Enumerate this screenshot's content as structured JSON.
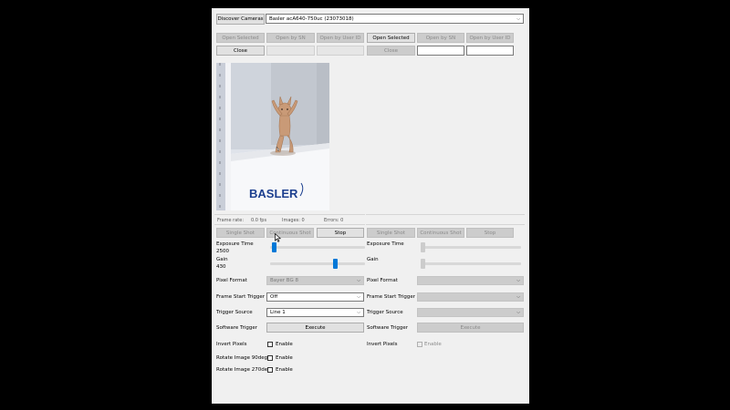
{
  "top": {
    "discover_label": "Discover Cameras",
    "camera_selected": "Basler acA640-750uc (23073018)"
  },
  "left_panel": {
    "open_selected": "Open Selected",
    "open_by_sn": "Open by SN",
    "open_by_user_id": "Open by User ID",
    "close": "Close",
    "status": {
      "frame_rate": "Frame rate:",
      "fps": "0.0 fps",
      "images": "Images: 0",
      "errors": "Errors: 0"
    },
    "single_shot": "Single Shot",
    "continuous_shot": "Continuous Shot",
    "stop": "Stop",
    "exposure_label": "Exposure Time",
    "exposure_value": "2500",
    "gain_label": "Gain",
    "gain_value": "430",
    "pixel_format_label": "Pixel Format",
    "pixel_format_value": "Bayer BG 8",
    "frame_start_trigger_label": "Frame Start Trigger",
    "frame_start_trigger_value": "Off",
    "trigger_source_label": "Trigger Source",
    "trigger_source_value": "Line 1",
    "software_trigger_label": "Software Trigger",
    "execute": "Execute",
    "invert_pixels_label": "Invert Pixels",
    "rotate_90_label": "Rotate Image 90deg",
    "rotate_270_label": "Rotate Image 270deg",
    "enable": "Enable",
    "image_text": "BASLER"
  },
  "right_panel": {
    "open_selected": "Open Selected",
    "open_by_sn": "Open by SN",
    "open_by_user_id": "Open by User ID",
    "close": "Close",
    "single_shot": "Single Shot",
    "continuous_shot": "Continuous Shot",
    "stop": "Stop",
    "exposure_label": "Exposure Time",
    "gain_label": "Gain",
    "pixel_format_label": "Pixel Format",
    "frame_start_trigger_label": "Frame Start Trigger",
    "trigger_source_label": "Trigger Source",
    "software_trigger_label": "Software Trigger",
    "execute": "Execute",
    "invert_pixels_label": "Invert Pixels",
    "enable": "Enable"
  },
  "sliders": {
    "left_exposure_level": 0.02,
    "left_gain_level": 0.7
  },
  "colors": {
    "accent": "#0078d7",
    "window_bg": "#f0f0f0"
  }
}
